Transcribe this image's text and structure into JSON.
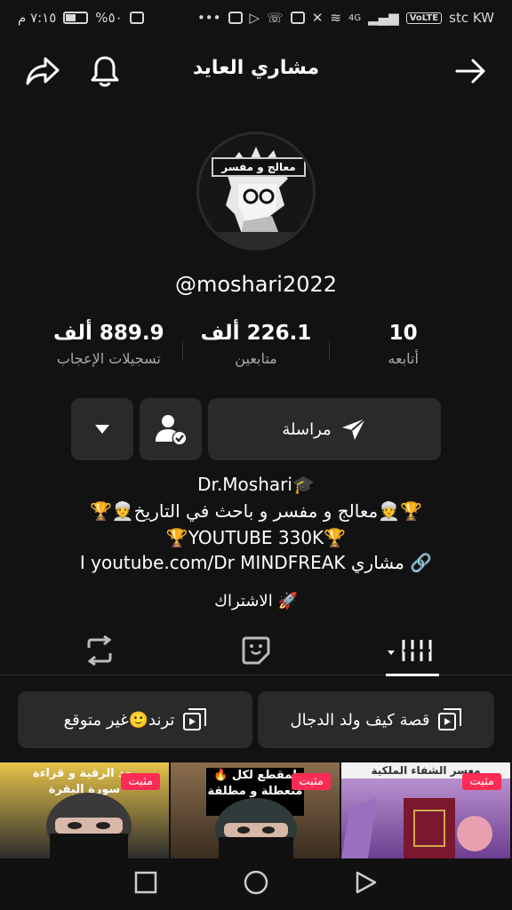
{
  "status": {
    "time": "٧:١٥ م",
    "battery": "%٥٠",
    "battery_level": 0.5,
    "network": "4G",
    "volte": "VoLTE",
    "carrier": "stc KW"
  },
  "header": {
    "title": "مشاري العايد"
  },
  "avatar": {
    "banner_text": "معالج و مفسر"
  },
  "profile": {
    "username": "@moshari2022"
  },
  "stats": [
    {
      "value": "10",
      "label": "أتابعه"
    },
    {
      "value": "226.1 ألف",
      "label": "متابعين"
    },
    {
      "value": "889.9 ألف",
      "label": "تسجيلات الإعجاب"
    }
  ],
  "actions": {
    "message_label": "مراسلة"
  },
  "bio": {
    "line1": "🎓Dr.Moshari",
    "line2": "🏆👳معالج و مفسر و باحث في التاريخ👳🏆",
    "line3": "🏆YOUTUBE 330K🏆",
    "link": "مشاري I youtube.com/Dr MINDFREAK",
    "subscribe": "الاشتراك"
  },
  "playlists": [
    {
      "label": "قصة كيف ولد الدجال"
    },
    {
      "label": "ترند🙂غير متوقع"
    }
  ],
  "videos": [
    {
      "pinned": "مثبت",
      "caption": "معسر الشفاء الملكية",
      "colors": [
        "#c9a0dc",
        "#6b3f8f"
      ]
    },
    {
      "pinned": "مثبت",
      "caption": "لمقطع لكل 🔥متعطلة و مطلقة🔥",
      "colors": [
        "#8b6e4e",
        "#3a2c1f"
      ]
    },
    {
      "pinned": "مثبت",
      "caption": "بعد الرقية و قراءة سورة البقرة",
      "colors": [
        "#e6c34a",
        "#2c2c2c"
      ]
    }
  ]
}
